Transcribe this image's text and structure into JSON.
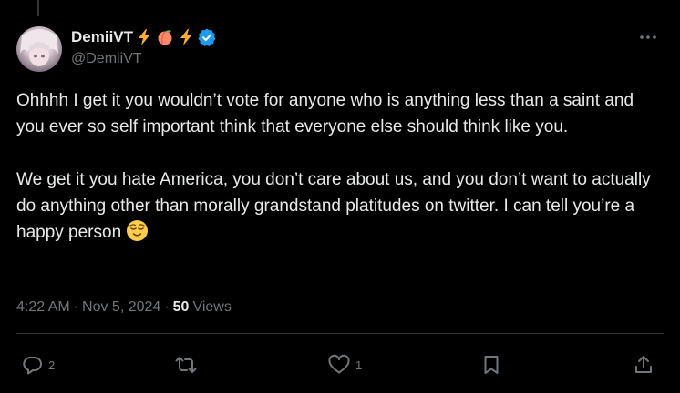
{
  "author": {
    "display_name": "DemiiVT",
    "handle": "@DemiiVT",
    "name_emojis": [
      "lightning-icon",
      "peach-icon",
      "lightning-icon"
    ],
    "verified": true
  },
  "body": {
    "paragraph1": "Ohhhh I get it you wouldn’t vote for anyone who is anything less than a saint and you ever so self important think that everyone else should think like you.",
    "paragraph2": "We get it you hate America, you don’t care about us, and you don’t want to actually do anything other than morally grandstand platitudes on twitter. I can tell you’re a happy person"
  },
  "meta": {
    "time": "4:22 AM",
    "sep1": "·",
    "date": "Nov 5, 2024",
    "sep2": "·",
    "views_count": "50",
    "views_label": "Views"
  },
  "actions": {
    "replies": "2",
    "reposts": "",
    "likes": "1"
  },
  "colors": {
    "background": "#000000",
    "text": "#e7e9ea",
    "muted": "#71767b",
    "verified": "#1d9bf0",
    "divider": "#2f3336"
  }
}
